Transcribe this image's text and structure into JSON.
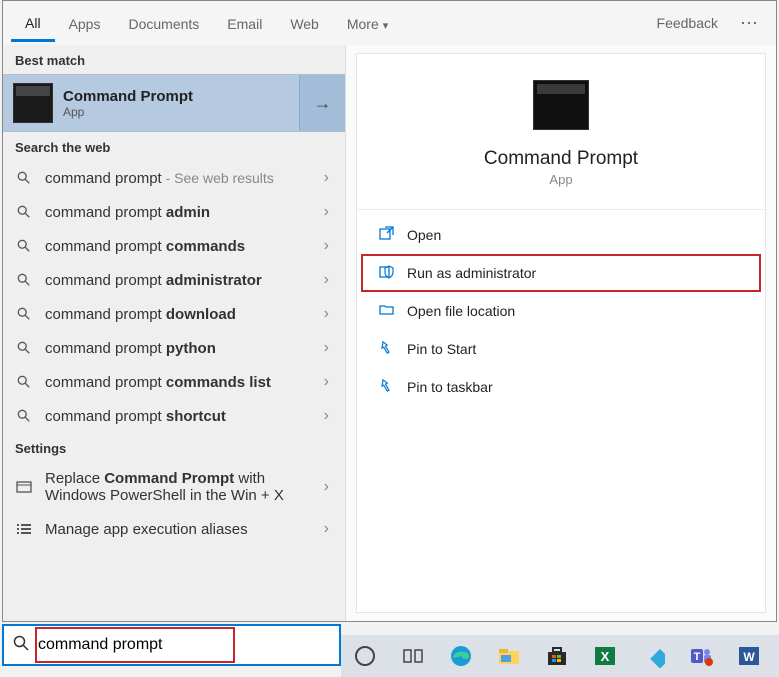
{
  "tabs": {
    "items": [
      "All",
      "Apps",
      "Documents",
      "Email",
      "Web",
      "More"
    ],
    "feedback": "Feedback"
  },
  "sections": {
    "best_match": "Best match",
    "search_web": "Search the web",
    "settings": "Settings"
  },
  "best": {
    "title": "Command Prompt",
    "subtitle": "App"
  },
  "web_results": [
    {
      "pre": "command prompt",
      "bold": "",
      "suffix": " - See web results"
    },
    {
      "pre": "command prompt ",
      "bold": "admin",
      "suffix": ""
    },
    {
      "pre": "command prompt ",
      "bold": "commands",
      "suffix": ""
    },
    {
      "pre": "command prompt ",
      "bold": "administrator",
      "suffix": ""
    },
    {
      "pre": "command prompt ",
      "bold": "download",
      "suffix": ""
    },
    {
      "pre": "command prompt ",
      "bold": "python",
      "suffix": ""
    },
    {
      "pre": "command prompt ",
      "bold": "commands list",
      "suffix": ""
    },
    {
      "pre": "command prompt ",
      "bold": "shortcut",
      "suffix": ""
    }
  ],
  "settings_results": [
    {
      "html_pre": "Replace ",
      "bold": "Command Prompt",
      "post": " with Windows PowerShell in the Win + X",
      "icon": "swap"
    },
    {
      "html_pre": "Manage app execution aliases",
      "bold": "",
      "post": "",
      "icon": "list"
    }
  ],
  "detail": {
    "title": "Command Prompt",
    "subtitle": "App",
    "actions": [
      {
        "icon": "open",
        "label": "Open",
        "highlight": false
      },
      {
        "icon": "admin",
        "label": "Run as administrator",
        "highlight": true
      },
      {
        "icon": "folder",
        "label": "Open file location",
        "highlight": false
      },
      {
        "icon": "pin-start",
        "label": "Pin to Start",
        "highlight": false
      },
      {
        "icon": "pin-taskbar",
        "label": "Pin to taskbar",
        "highlight": false
      }
    ]
  },
  "search": {
    "value": "command prompt",
    "icon": "search-icon"
  },
  "taskbar": {
    "items": [
      "cortana",
      "task-view",
      "edge",
      "explorer",
      "store",
      "excel",
      "kodi",
      "teams",
      "word"
    ]
  }
}
